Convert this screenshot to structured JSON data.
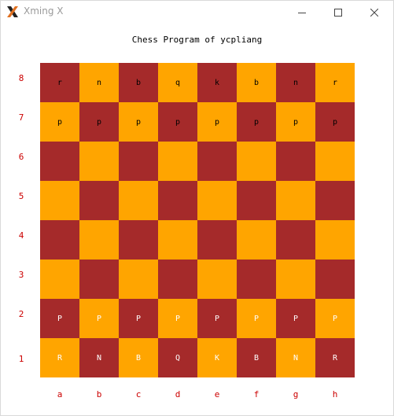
{
  "window": {
    "title": "Xming X",
    "icon": "xming-x-logo",
    "controls": [
      "minimize-icon",
      "maximize-icon",
      "close-icon"
    ]
  },
  "heading": "Chess Program of ycpliang",
  "board": {
    "colors": {
      "dark": "#a52a2a",
      "light": "#ffa500",
      "black_piece_text": "#000000",
      "white_piece_text": "#ffffff",
      "coord_text": "#cc0000"
    },
    "rows": [
      {
        "rank": "8",
        "cells": [
          "r",
          "n",
          "b",
          "q",
          "k",
          "b",
          "n",
          "r"
        ]
      },
      {
        "rank": "7",
        "cells": [
          "p",
          "p",
          "p",
          "p",
          "p",
          "p",
          "p",
          "p"
        ]
      },
      {
        "rank": "6",
        "cells": [
          "",
          "",
          "",
          "",
          "",
          "",
          "",
          ""
        ]
      },
      {
        "rank": "5",
        "cells": [
          "",
          "",
          "",
          "",
          "",
          "",
          "",
          ""
        ]
      },
      {
        "rank": "4",
        "cells": [
          "",
          "",
          "",
          "",
          "",
          "",
          "",
          ""
        ]
      },
      {
        "rank": "3",
        "cells": [
          "",
          "",
          "",
          "",
          "",
          "",
          "",
          ""
        ]
      },
      {
        "rank": "2",
        "cells": [
          "P",
          "P",
          "P",
          "P",
          "P",
          "P",
          "P",
          "P"
        ]
      },
      {
        "rank": "1",
        "cells": [
          "R",
          "N",
          "B",
          "Q",
          "K",
          "B",
          "N",
          "R"
        ]
      }
    ],
    "files": [
      "a",
      "b",
      "c",
      "d",
      "e",
      "f",
      "g",
      "h"
    ]
  }
}
